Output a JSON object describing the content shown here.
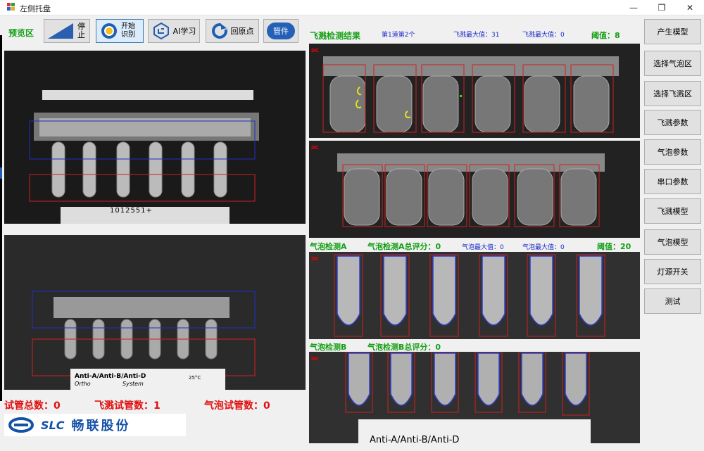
{
  "window": {
    "title": "左侧托盘",
    "minimize_glyph": "—",
    "maximize_glyph": "❐",
    "close_glyph": "✕"
  },
  "toolbar": {
    "preview_label": "预览区",
    "stop_label": "停止",
    "start_label": "开始识别",
    "ai_label": "AI学习",
    "home_label": "回原点",
    "bottom_label": "管件"
  },
  "results": {
    "splash_title": "飞溅检测结果",
    "splash_tube_info": "第1道第2个",
    "splash_max_a": "飞溅最大值：31",
    "splash_max_b": "飞溅最大值：0",
    "splash_threshold": "阈值：8",
    "bubble_a_title": "气泡检测A",
    "bubble_a_score": "气泡检测A总评分：0",
    "bubble_max_a": "气泡最大值：0",
    "bubble_max_b": "气泡最大值：0",
    "bubble_threshold": "阈值：20",
    "bubble_b_title": "气泡检测B",
    "bubble_b_score": "气泡检测B总评分：0",
    "panel_tag": "DC"
  },
  "right_buttons": [
    "产生模型",
    "选择气泡区",
    "选择飞溅区",
    "飞溅参数",
    "气泡参数",
    "串口参数",
    "飞溅模型",
    "气泡模型",
    "灯源开关",
    "测试"
  ],
  "stats": {
    "total_label": "试管总数：",
    "total_value": "0",
    "splash_label": "飞溅试管数：",
    "splash_value": "1",
    "bubble_label": "气泡试管数：",
    "bubble_value": "0"
  },
  "camera": {
    "barcode_text": "1012551+",
    "card_line1": "Anti-A/Anti-B/Anti-D",
    "card_line2": "Ortho",
    "card_line3": "System",
    "card_temp": "25°C",
    "bottom_card_text": "Anti-A/Anti-B/Anti-D"
  },
  "logo": {
    "brand": "SLC",
    "company": "畅联股份"
  },
  "colors": {
    "accent_green": "#15a015",
    "stat_red": "#e01010",
    "info_blue": "#1a2ac8",
    "roi_red": "#d02020",
    "roi_blue": "#2030c0"
  }
}
